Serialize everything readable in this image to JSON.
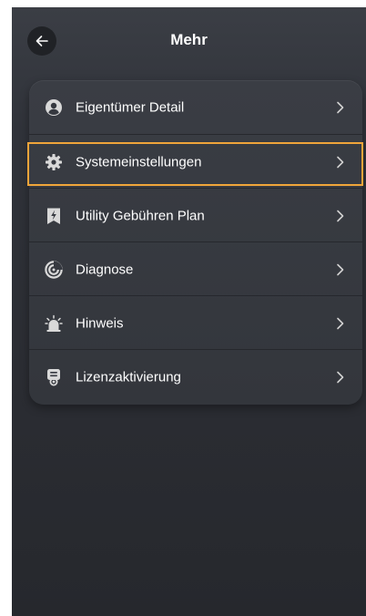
{
  "header": {
    "title": "Mehr",
    "back_icon": "arrow-left-icon"
  },
  "menu": {
    "items": [
      {
        "label": "Eigentümer Detail",
        "icon": "user-circle-icon"
      },
      {
        "label": "Systemeinstellungen",
        "icon": "gear-icon",
        "highlighted": true
      },
      {
        "label": "Utility Gebühren Plan",
        "icon": "bookmark-bolt-icon"
      },
      {
        "label": "Diagnose",
        "icon": "diagnose-gauge-icon"
      },
      {
        "label": "Hinweis",
        "icon": "alarm-siren-icon"
      },
      {
        "label": "Lizenzaktivierung",
        "icon": "license-certificate-icon"
      }
    ],
    "chevron_icon": "chevron-right-icon"
  },
  "colors": {
    "background": "#2b2d33",
    "card": "#373a40",
    "highlight_border": "#f0a53a",
    "icon": "#d9d9d9",
    "text": "#ffffff"
  }
}
